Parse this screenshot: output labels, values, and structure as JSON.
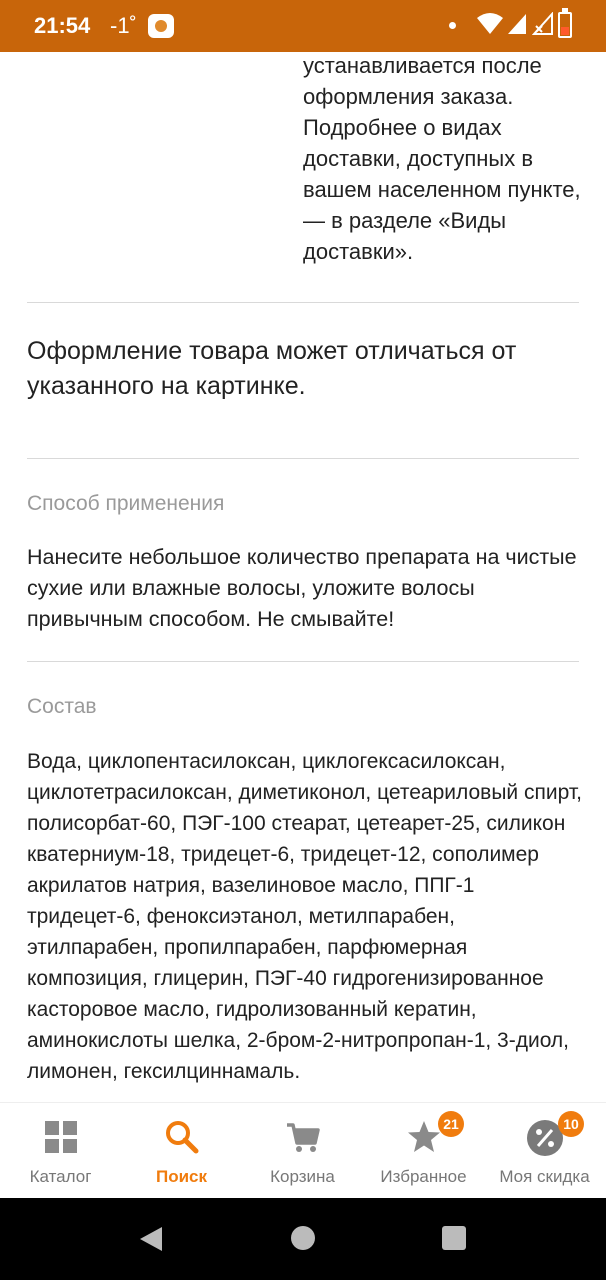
{
  "status_bar": {
    "time": "21:54",
    "temperature": "-1˚",
    "bg_color": "#c8650a"
  },
  "delivery": {
    "text": "устанавливается после оформления заказа. Подробнее о видах доставки, доступных в вашем населенном пункте, — в разделе «Виды доставки»."
  },
  "notice": "Оформление товара может отличаться от указанного на картинке.",
  "usage": {
    "title": "Способ применения",
    "text": "Нанесите небольшое количество препарата на чистые сухие или влажные волосы, уложите волосы привычным способом. Не смывайте!"
  },
  "composition": {
    "title": "Состав",
    "text": "Вода, циклопентасилоксан, циклогексасилоксан, циклотетрасилоксан, диметиконол, цетеариловый спирт, полисорбат-60, ПЭГ-100 стеарат, цетеарет-25, силикон кватерниум-18, тридецет-6, тридецет-12, сополимер акрилатов натрия, вазелиновое масло, ППГ-1 тридецет-6, феноксиэтанол, метилпарабен, этилпарабен, пропилпарабен, парфюмерная композиция, глицерин, ПЭГ-40 гидрогенизированное касторовое масло, гидролизованный кератин, аминокислоты шелка, 2-бром-2-нитропропан-1, 3-диол, лимонен, гексилциннамаль."
  },
  "bottom_nav": {
    "accent_color": "#f07c0e",
    "items": [
      {
        "label": "Каталог",
        "icon": "grid-icon",
        "active": false
      },
      {
        "label": "Поиск",
        "icon": "search-icon",
        "active": true
      },
      {
        "label": "Корзина",
        "icon": "cart-icon",
        "active": false
      },
      {
        "label": "Избранное",
        "icon": "star-icon",
        "active": false,
        "badge": "21"
      },
      {
        "label": "Моя скидка",
        "icon": "discount-icon",
        "active": false,
        "badge": "10"
      }
    ]
  }
}
